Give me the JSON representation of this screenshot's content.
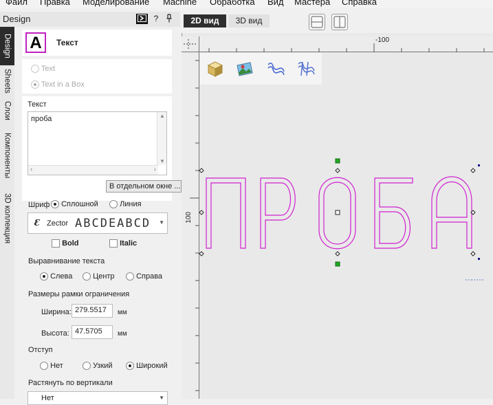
{
  "menu": [
    "Файл",
    "Правка",
    "Моделирование",
    "Machine",
    "Обработка",
    "Вид",
    "Мастера",
    "Справка"
  ],
  "panel": {
    "title": "Design",
    "help_label": "?",
    "pin_label": "ᵽ",
    "tabs": [
      "Design",
      "Sheets",
      "Слои",
      "Компоненты",
      "3D коллекция"
    ]
  },
  "text_tool": {
    "title": "Текст",
    "icon_letter": "A",
    "mode_options": [
      {
        "label": "Text",
        "selected": false
      },
      {
        "label": "Text in a Box",
        "selected": true
      }
    ],
    "text_label": "Текст",
    "text_value": "проба",
    "separate_window_button": "В отдельном окне ...",
    "font_label": "Шриф",
    "font_type_options": [
      {
        "label": "Сплошной",
        "selected": true
      },
      {
        "label": "Линия",
        "selected": false
      }
    ],
    "font_name": "Zector",
    "font_preview": "ABCDEABCD",
    "bold_label": "Bold",
    "italic_label": "Italic",
    "align_label": "Выравнивание текста",
    "align_options": [
      {
        "label": "Слева",
        "selected": true
      },
      {
        "label": "Центр",
        "selected": false
      },
      {
        "label": "Справа",
        "selected": false
      }
    ],
    "bbox_label": "Размеры рамки ограничения",
    "width_label": "Ширина:",
    "width_value": "279.5517",
    "width_unit": "мм",
    "height_label": "Высота:",
    "height_value": "47.5705",
    "height_unit": "мм",
    "indent_label": "Отступ",
    "indent_options": [
      {
        "label": "Нет",
        "selected": false
      },
      {
        "label": "Узкий",
        "selected": false
      },
      {
        "label": "Широкий",
        "selected": true
      }
    ],
    "stretch_label": "Растянуть по вертикали",
    "stretch_value": "Нет"
  },
  "view": {
    "tabs": [
      {
        "label": "2D вид",
        "active": true
      },
      {
        "label": "3D вид",
        "active": false
      }
    ],
    "ruler_top_label": "-100",
    "ruler_left_label": "100",
    "canvas_text": "ПРОБА",
    "text_color": "#d020d0",
    "handle_color": "#22aa22",
    "toolbar_icons": [
      "cube-icon",
      "image-icon",
      "wave-vectors-icon",
      "relief-vectors-icon"
    ]
  }
}
